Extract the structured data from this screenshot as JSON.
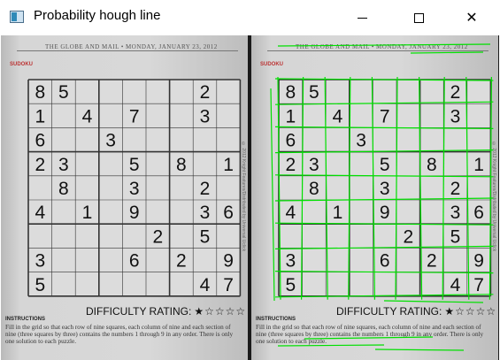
{
  "window": {
    "title": "Probability hough line",
    "icon": "app-window-icon",
    "controls": {
      "minimize": "minimize-icon",
      "maximize": "maximize-icon",
      "close": "close-icon",
      "close_glyph": "✕"
    }
  },
  "newspaper": {
    "masthead": "THE GLOBE AND MAIL  •  MONDAY, JANUARY 23, 2012",
    "section": "SUDOKU",
    "rating_label": "DIFFICULTY RATING:",
    "rating_stars": "★☆☆☆☆",
    "instructions_title": "INSTRUCTIONS",
    "instructions_text": "Fill in the grid so that each row of nine squares, each column of nine and each section of nine (three squares by three) contains the numbers 1 through 9 in any order. There is only one solution to each puzzle.",
    "side_credit": "© 2012 Knight Features/Distributed by Universal Uclick"
  },
  "sudoku": {
    "rows": [
      [
        "8",
        "5",
        "",
        "",
        "",
        "",
        "",
        "2",
        ""
      ],
      [
        "1",
        "",
        "4",
        "",
        "7",
        "",
        "",
        "3",
        ""
      ],
      [
        "6",
        "",
        "",
        "3",
        "",
        "",
        "",
        "",
        ""
      ],
      [
        "2",
        "3",
        "",
        "",
        "5",
        "",
        "8",
        "",
        "1"
      ],
      [
        "",
        "8",
        "",
        "",
        "3",
        "",
        "",
        "2",
        ""
      ],
      [
        "4",
        "",
        "1",
        "",
        "9",
        "",
        "",
        "3",
        "6"
      ],
      [
        "",
        "",
        "",
        "",
        "",
        "2",
        "",
        "5",
        ""
      ],
      [
        "3",
        "",
        "",
        "",
        "6",
        "",
        "2",
        "",
        "9"
      ],
      [
        "5",
        "",
        "",
        "",
        "",
        "",
        "",
        "4",
        "7"
      ]
    ]
  },
  "colors": {
    "hough_line": "#00e000",
    "titlebar_bg": "#ffffff",
    "divider": "#1a1a1a"
  }
}
